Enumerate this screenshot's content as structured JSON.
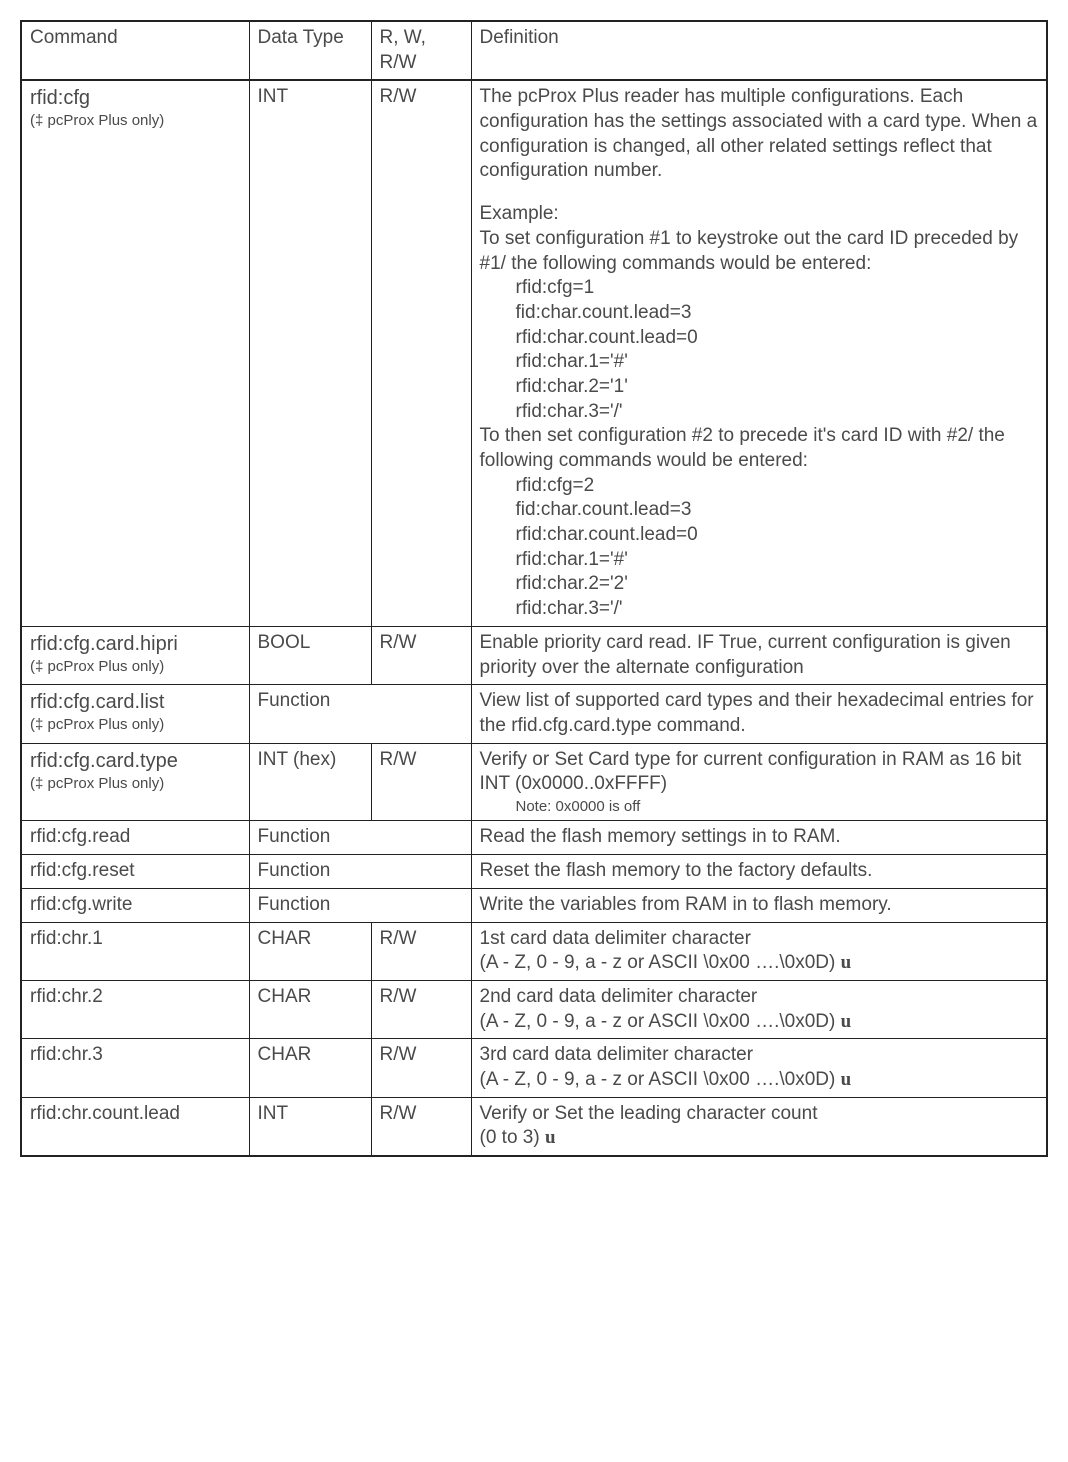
{
  "headers": {
    "command": "Command",
    "datatype": "Data Type",
    "rw": "R, W, R/W",
    "definition": "Definition"
  },
  "rows": [
    {
      "cmd": "rfid:cfg",
      "sub": "(‡ pcProx Plus only)",
      "dt": "INT",
      "rw": "R/W",
      "def_html": "cfg"
    },
    {
      "cmd": "rfid:cfg.card.hipri",
      "sub": "(‡ pcProx Plus only)",
      "dt": "BOOL",
      "rw": "R/W",
      "def": "Enable priority card read. IF True, current configuration is given priority over the alternate configuration"
    },
    {
      "cmd": "rfid:cfg.card.list",
      "sub": "(‡ pcProx Plus only)",
      "merged_dt_rw": "Function",
      "def": "View list of supported card types and their hexadecimal entries for the rfid.cfg.card.type command."
    },
    {
      "cmd": "rfid:cfg.card.type",
      "sub": "(‡ pcProx Plus only)",
      "dt": "INT (hex)",
      "rw": "R/W",
      "def_html": "type"
    },
    {
      "cmd": "rfid:cfg.read",
      "merged_dt_rw": "Function",
      "def": "Read the flash memory settings in to RAM."
    },
    {
      "cmd": "rfid:cfg.reset",
      "merged_dt_rw": "Function",
      "def": "Reset the flash memory to the factory defaults."
    },
    {
      "cmd": "rfid:cfg.write",
      "merged_dt_rw": "Function",
      "def": "Write the variables from RAM in to flash  memory."
    },
    {
      "cmd": "rfid:chr.1",
      "dt": "CHAR",
      "rw": "R/W",
      "def_html": "chr1"
    },
    {
      "cmd": "rfid:chr.2",
      "dt": "CHAR",
      "rw": "R/W",
      "def_html": "chr2"
    },
    {
      "cmd": "rfid:chr.3",
      "dt": "CHAR",
      "rw": "R/W",
      "def_html": "chr3"
    },
    {
      "cmd": "rfid:chr.count.lead",
      "dt": "INT",
      "rw": "R/W",
      "def_html": "countlead"
    }
  ],
  "defs": {
    "cfg": {
      "para1": "The pcProx Plus reader has multiple configurations. Each configuration  has the settings associated with a card type. When a configuration is changed, all other related settings reflect that configuration number.",
      "example_label": "Example:",
      "para2": "To set configuration  #1 to keystroke out the card ID preceded by #1/  the following commands would be entered:",
      "code1": [
        "rfid:cfg=1",
        "fid:char.count.lead=3",
        "rfid:char.count.lead=0",
        "rfid:char.1='#'",
        "rfid:char.2='1'",
        "rfid:char.3='/'"
      ],
      "para3": "To then set configuration  #2 to precede it's card ID with #2/  the following commands would be entered:",
      "code2": [
        "rfid:cfg=2",
        "fid:char.count.lead=3",
        "rfid:char.count.lead=0",
        "rfid:char.1='#'",
        "rfid:char.2='2'",
        "rfid:char.3='/'"
      ]
    },
    "type": {
      "line1": "Verify or Set Card type for current configuration in RAM  as 16 bit INT (0x0000..0xFFFF)",
      "note": "Note: 0x0000  is off"
    },
    "chr1": {
      "line1": "1st card data delimiter character",
      "line2": "(A - Z, 0 - 9, a - z or ASCII \\0x00 ….\\0x0D) ",
      "u": "u"
    },
    "chr2": {
      "line1": "2nd card data delimiter character",
      "line2": "(A - Z, 0 - 9, a - z or ASCII \\0x00 ….\\0x0D) ",
      "u": "u"
    },
    "chr3": {
      "line1": "3rd card data delimiter character",
      "line2": "(A - Z, 0 - 9, a - z or ASCII \\0x00 ….\\0x0D) ",
      "u": "u"
    },
    "countlead": {
      "line1": "Verify or Set the leading character count",
      "line2": "(0 to 3) ",
      "u": "u"
    }
  },
  "chart_data": {
    "type": "table",
    "columns": [
      "Command",
      "Data Type",
      "R, W, R/W",
      "Definition"
    ],
    "rows": [
      [
        "rfid:cfg (‡ pcProx Plus only)",
        "INT",
        "R/W",
        "The pcProx Plus reader has multiple configurations. Each configuration has the settings associated with a card type. When a configuration is changed, all other related settings reflect that configuration number. Example: To set configuration #1 to keystroke out the card ID preceded by #1/ the following commands would be entered: rfid:cfg=1 fid:char.count.lead=3 rfid:char.count.lead=0 rfid:char.1='#' rfid:char.2='1' rfid:char.3='/' To then set configuration #2 to precede it's card ID with #2/ the following commands would be entered: rfid:cfg=2 fid:char.count.lead=3 rfid:char.count.lead=0 rfid:char.1='#' rfid:char.2='2' rfid:char.3='/'"
      ],
      [
        "rfid:cfg.card.hipri (‡ pcProx Plus only)",
        "BOOL",
        "R/W",
        "Enable priority card read. IF True, current configuration is given priority over the alternate configuration"
      ],
      [
        "rfid:cfg.card.list (‡ pcProx Plus only)",
        "Function",
        "",
        "View list of supported card types and their hexadecimal entries for the rfid.cfg.card.type command."
      ],
      [
        "rfid:cfg.card.type (‡ pcProx Plus only)",
        "INT (hex)",
        "R/W",
        "Verify or Set Card type for current configuration in RAM as 16 bit INT (0x0000..0xFFFF) Note: 0x0000 is off"
      ],
      [
        "rfid:cfg.read",
        "Function",
        "",
        "Read the flash memory settings in to RAM."
      ],
      [
        "rfid:cfg.reset",
        "Function",
        "",
        "Reset the flash memory to the factory defaults."
      ],
      [
        "rfid:cfg.write",
        "Function",
        "",
        "Write the variables from RAM in to flash memory."
      ],
      [
        "rfid:chr.1",
        "CHAR",
        "R/W",
        "1st card data delimiter character (A - Z, 0 - 9, a - z or ASCII \\0x00 ….\\0x0D) u"
      ],
      [
        "rfid:chr.2",
        "CHAR",
        "R/W",
        "2nd card data delimiter character (A - Z, 0 - 9, a - z or ASCII \\0x00 ….\\0x0D) u"
      ],
      [
        "rfid:chr.3",
        "CHAR",
        "R/W",
        "3rd card data delimiter character (A - Z, 0 - 9, a - z or ASCII \\0x00 ….\\0x0D) u"
      ],
      [
        "rfid:chr.count.lead",
        "INT",
        "R/W",
        "Verify or Set the leading character count (0 to 3) u"
      ]
    ]
  }
}
